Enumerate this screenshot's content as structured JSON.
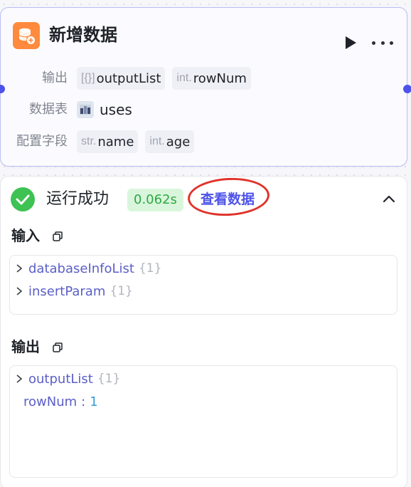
{
  "node": {
    "title": "新增数据",
    "output_label": "输出",
    "outputs": [
      {
        "type": "[{}]",
        "name": "outputList"
      },
      {
        "type": "int.",
        "name": "rowNum"
      }
    ],
    "table_label": "数据表",
    "table_name": "uses",
    "fields_label": "配置字段",
    "fields": [
      {
        "type": "str.",
        "name": "name"
      },
      {
        "type": "int.",
        "name": "age"
      }
    ]
  },
  "result": {
    "status": "运行成功",
    "duration": "0.062s",
    "view_link": "查看数据",
    "input_title": "输入",
    "inputs": [
      {
        "key": "databaseInfoList",
        "count": "{1}"
      },
      {
        "key": "insertParam",
        "count": "{1}"
      }
    ],
    "output_title": "输出",
    "outputs": [
      {
        "key": "outputList",
        "count": "{1}"
      },
      {
        "key": "rowNum",
        "value": "1"
      }
    ]
  },
  "colors": {
    "accent": "#4d53e8",
    "node_icon": "#ff8a3d",
    "success": "#3ec254",
    "annotation": "#e0332b"
  },
  "icons": [
    "database-add-icon",
    "play-icon",
    "more-icon",
    "success-check-icon",
    "chevron-up-icon",
    "copy-icon",
    "chevron-right-icon",
    "table-icon"
  ]
}
